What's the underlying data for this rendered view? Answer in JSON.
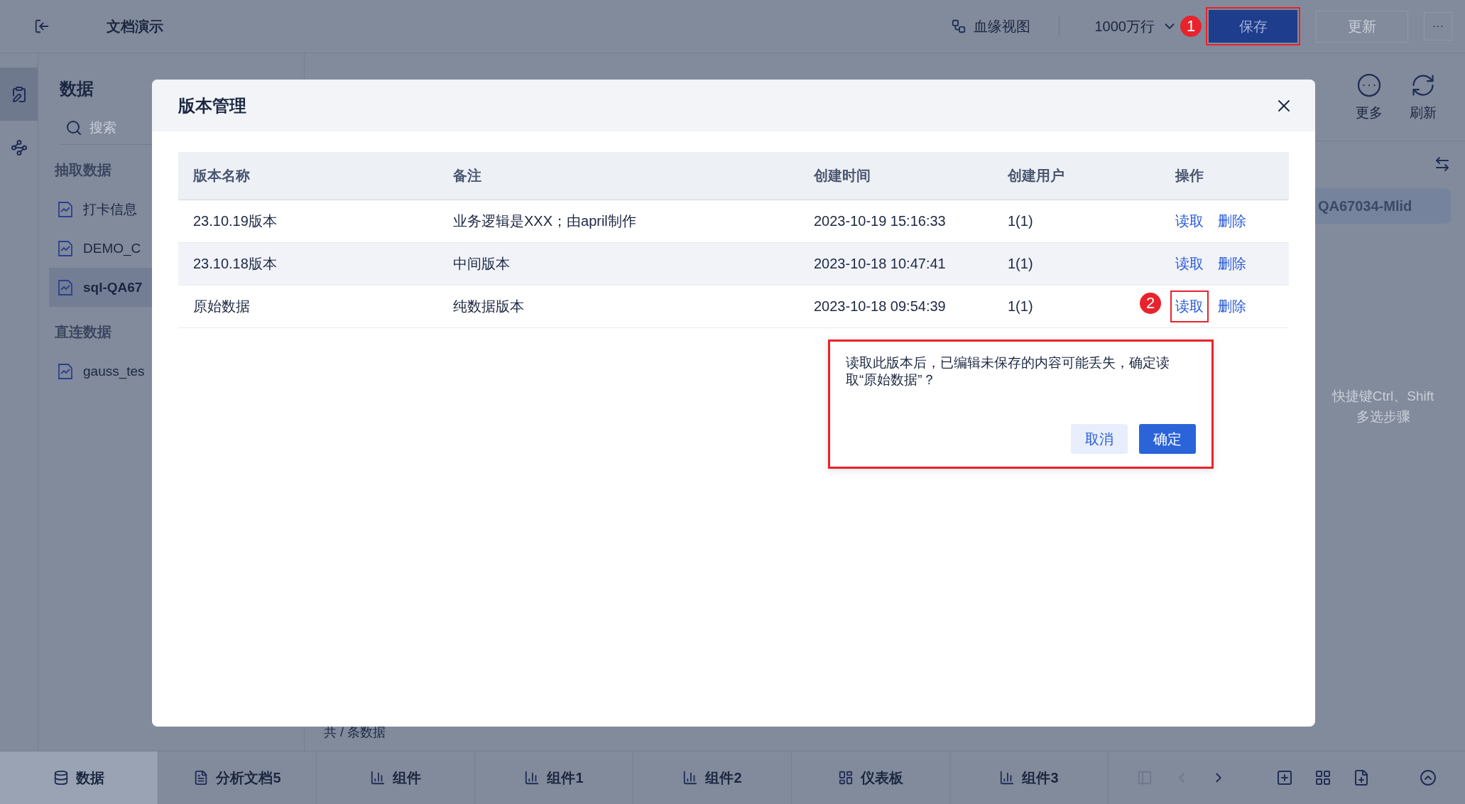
{
  "topbar": {
    "title": "文档演示",
    "lineage": "血缘视图",
    "row_limit": "1000万行",
    "save": {
      "label": "保存",
      "annotation": "1"
    },
    "update": {
      "label": "更新",
      "disabled": true
    },
    "more": "···"
  },
  "rail": [
    {
      "kind": "edit",
      "selected": true
    },
    {
      "kind": "nodes",
      "selected": false
    }
  ],
  "data_panel": {
    "title": "数据",
    "search": {
      "placeholder": "搜索"
    },
    "groups": [
      {
        "title": "抽取数据",
        "items": [
          {
            "name": "打卡信息",
            "selected": false
          },
          {
            "name": "DEMO_C",
            "selected": false
          },
          {
            "name": "sql-QA67",
            "selected": true
          }
        ]
      },
      {
        "title": "直连数据",
        "items": [
          {
            "name": "gauss_tes",
            "selected": false
          }
        ]
      }
    ]
  },
  "toolbar": [
    {
      "kind": "more",
      "label": "更多"
    },
    {
      "kind": "refresh",
      "label": "刷新"
    }
  ],
  "steps_panel": {
    "item": "QA67034-Mlid",
    "hint": [
      "快捷键Ctrl、Shift",
      "多选步骤"
    ]
  },
  "table_footer": "共 / 条数据",
  "bottom_tabs": [
    {
      "kind": "data",
      "label": "数据",
      "selected": true
    },
    {
      "kind": "doc",
      "label": "分析文档5",
      "selected": false
    },
    {
      "kind": "component",
      "label": "组件",
      "selected": false
    },
    {
      "kind": "component",
      "label": "组件1",
      "selected": false
    },
    {
      "kind": "component",
      "label": "组件2",
      "selected": false
    },
    {
      "kind": "dashboard",
      "label": "仪表板",
      "selected": false
    },
    {
      "kind": "component",
      "label": "组件3",
      "selected": false
    }
  ],
  "dialog": {
    "title": "版本管理",
    "columns": [
      "版本名称",
      "备注",
      "创建时间",
      "创建用户",
      "操作"
    ],
    "rows": [
      {
        "cells": [
          "23.10.19版本",
          "业务逻辑是XXX；由april制作",
          "2023-10-19 15:16:33",
          "1(1)"
        ],
        "actions": [
          "读取",
          "删除"
        ],
        "hovered": false
      },
      {
        "cells": [
          "23.10.18版本",
          "中间版本",
          "2023-10-18 10:47:41",
          "1(1)"
        ],
        "actions": [
          "读取",
          "删除"
        ],
        "hovered": true
      },
      {
        "cells": [
          "原始数据",
          "纯数据版本",
          "2023-10-18 09:54:39",
          "1(1)"
        ],
        "actions": [
          "读取",
          "删除"
        ],
        "hovered": false,
        "annotation": "2"
      }
    ]
  },
  "confirm": {
    "message": "读取此版本后，已编辑未保存的内容可能丢失，确定读取“原始数据”？",
    "cancel": "取消",
    "ok": "确定"
  }
}
